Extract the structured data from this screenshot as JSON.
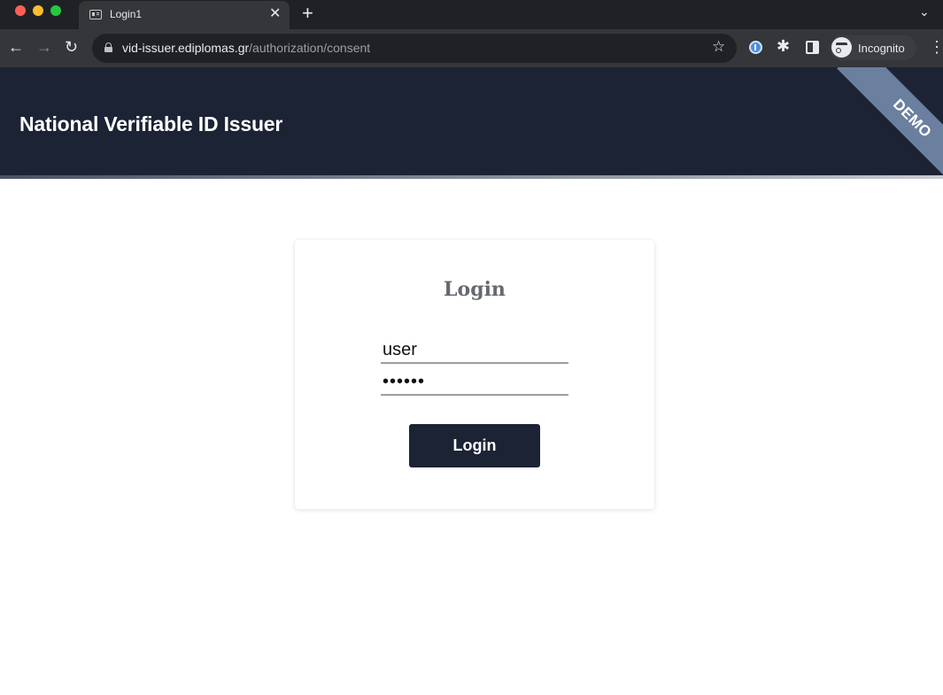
{
  "browser": {
    "tab": {
      "title": "Login1",
      "favicon": "id-card-icon",
      "close_glyph": "✕"
    },
    "new_tab_glyph": "+",
    "address_bar": {
      "host": "vid-issuer.ediplomas.gr",
      "path": "/authorization/consent"
    },
    "profile_label": "Incognito",
    "icons": {
      "back": "←",
      "forward": "→",
      "reload": "↻",
      "star": "☆",
      "puzzle": "✱",
      "menu": "⋮",
      "chevron": "⌄"
    }
  },
  "site": {
    "title": "National Verifiable ID Issuer",
    "ribbon": "DEMO",
    "header_color": "#1c2335",
    "ribbon_color": "#6b7f9e"
  },
  "login_form": {
    "heading": "Login",
    "username_value": "user",
    "password_value": "••••••",
    "submit_label": "Login"
  }
}
